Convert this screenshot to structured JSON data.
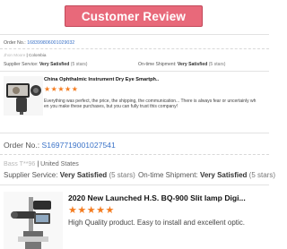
{
  "header": {
    "title": "Customer Review"
  },
  "colors": {
    "banner": "#e8697a",
    "order_link": "#3b73c8",
    "stars": "#f47c20"
  },
  "reviews": [
    {
      "order_label": "Order No.:",
      "order_number": "168399806001029032",
      "buyer_name": "Jhon Moore",
      "buyer_country": "Colombia",
      "supplier_label": "Supplier Service:",
      "supplier_rating": "Very Satisfied",
      "supplier_stars": "(5 stars)",
      "shipment_label": "On-time Shipment:",
      "shipment_rating": "Very Satisfied",
      "shipment_stars": "(5 stars)",
      "product_title": "China Ophthalmic Instrument Dry Eye Smartph..",
      "stars_display": "★★★★★",
      "rating": 5,
      "review_text": "Everything was perfect, the price, the shipping, the communication... There is always fear or uncertainly wh",
      "review_text_2": "en you make these purchases, but you can fully trust this company!"
    },
    {
      "order_label": "Order No.:",
      "order_number": "S1697719001027541",
      "buyer_name": "Bass T**96",
      "buyer_country": "United States",
      "supplier_label": "Supplier Service:",
      "supplier_rating": "Very Satisfied",
      "supplier_stars": "(5 stars)",
      "shipment_label": "On-time Shipment:",
      "shipment_rating": "Very Satisfied",
      "shipment_stars": "(5 stars)",
      "product_title": "2020 New Launched H.S. BQ-900 Slit lamp Digi...",
      "stars_display": "★★★★★",
      "rating": 5,
      "review_text": "High Quality product. Easy to install and excellent optic."
    }
  ]
}
